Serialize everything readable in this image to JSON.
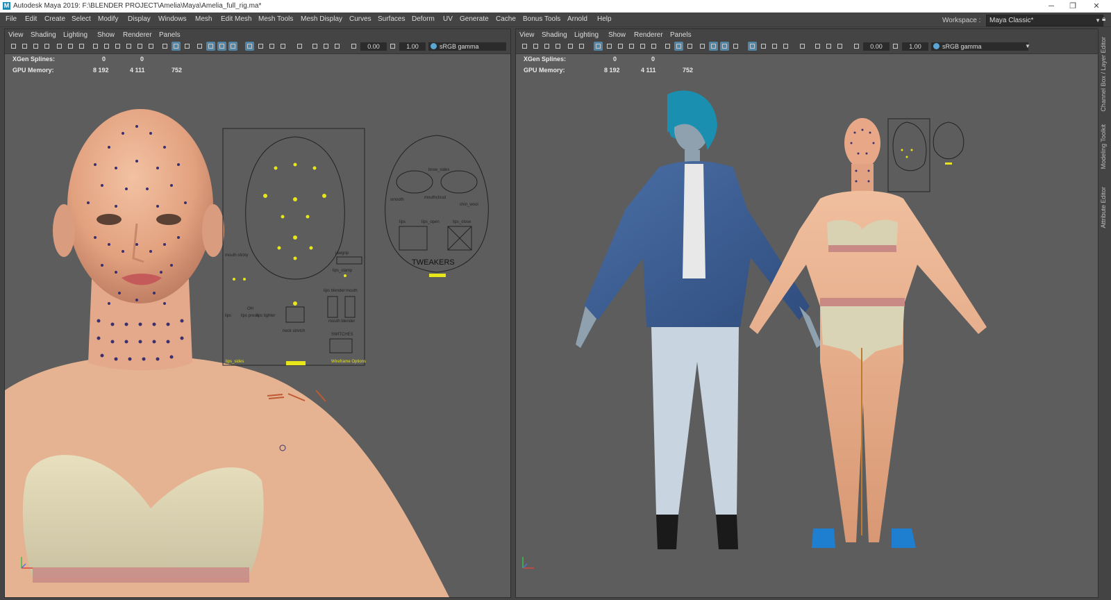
{
  "titlebar": {
    "title": "Autodesk Maya 2019: F:\\BLENDER PROJECT\\Amelia\\Maya\\Amelia_full_rig.ma*",
    "logo_letter": "M"
  },
  "menubar": [
    "File",
    "Edit",
    "Create",
    "Select",
    "Modify",
    "Display",
    "Windows",
    "Mesh",
    "Edit Mesh",
    "Mesh Tools",
    "Mesh Display",
    "Curves",
    "Surfaces",
    "Deform",
    "UV",
    "Generate",
    "Cache",
    "Bonus Tools",
    "Arnold",
    "Help"
  ],
  "workspace": {
    "label": "Workspace :",
    "value": "Maya Classic*"
  },
  "panels": [
    {
      "menu": [
        "View",
        "Shading",
        "Lighting",
        "Show",
        "Renderer",
        "Panels"
      ],
      "exposure": "0.00",
      "gamma": "1.00",
      "colorspace": "sRGB gamma",
      "hud": {
        "xgen_label": "XGen Splines:",
        "xgen_a": "0",
        "xgen_b": "0",
        "gpu_label": "GPU Memory:",
        "gpu_a": "8 192",
        "gpu_b": "4 111",
        "gpu_c": "752"
      }
    },
    {
      "menu": [
        "View",
        "Shading",
        "Lighting",
        "Show",
        "Renderer",
        "Panels"
      ],
      "exposure": "0.00",
      "gamma": "1.00",
      "colorspace": "sRGB gamma",
      "hud": {
        "xgen_label": "XGen Splines:",
        "xgen_a": "0",
        "xgen_b": "0",
        "gpu_label": "GPU Memory:",
        "gpu_a": "8 192",
        "gpu_b": "4 111",
        "gpu_c": "752"
      }
    }
  ],
  "face_ui": {
    "tweakers_label": "TWEAKERS",
    "labels": [
      "mouth sticky",
      "jawgrip",
      "lips_clamp",
      "lips",
      "lips press",
      "lips tighter",
      "mouth",
      "lips blender",
      "mouth blender",
      "OH",
      "neck stretch",
      "SWITCHES",
      "lips_sides",
      "Wireframe Options",
      "mouthcloud",
      "smooth",
      "brow_sides",
      "chin_wool",
      "lips",
      "lips_open",
      "lips_close"
    ]
  },
  "colors": {
    "viewport_bg": "#5d5d5d",
    "ui_bg": "#444444",
    "selection_blue": "#5285a6",
    "control_yellow": "#e6e61a",
    "skin": "#e8b08f",
    "jacket": "#3d5f95",
    "hair": "#1b8fb0"
  },
  "right_sidebar": {
    "tabs": [
      "Channel Box / Layer Editor",
      "Modeling Toolkit",
      "Attribute Editor"
    ]
  }
}
